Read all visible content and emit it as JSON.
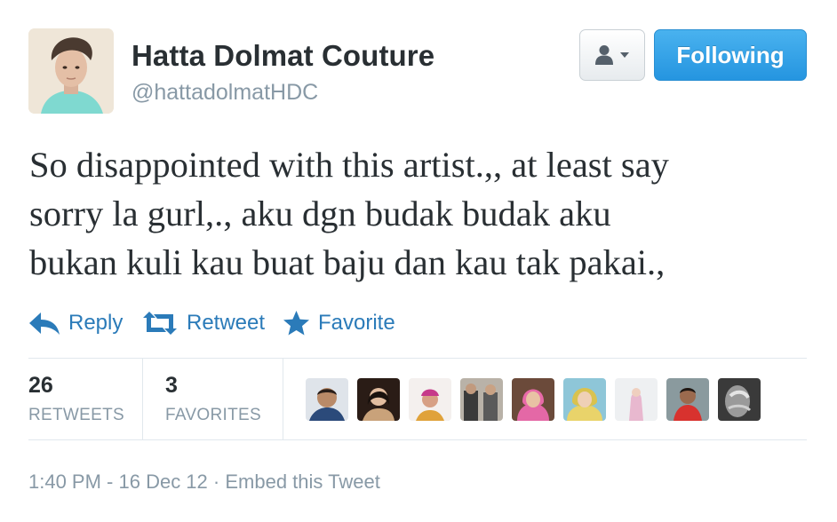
{
  "user": {
    "name": "Hatta Dolmat Couture",
    "screen_name": "@hattadolmatHDC",
    "avatar_icon": "user-avatar-photo"
  },
  "header": {
    "dropdown_icon": "user-silhouette-icon",
    "follow_label": "Following"
  },
  "tweet": {
    "lines": [
      "So disappointed with this artist.,, at least say",
      "sorry la gurl,., aku dgn budak budak aku",
      "bukan kuli kau buat baju dan kau tak pakai.,"
    ]
  },
  "actions": {
    "reply": "Reply",
    "retweet": "Retweet",
    "favorite": "Favorite"
  },
  "stats": {
    "retweets_count": "26",
    "retweets_label": "RETWEETS",
    "favorites_count": "3",
    "favorites_label": "FAVORITES"
  },
  "favoriters": [
    {
      "avatar_icon": "user-avatar-photo"
    },
    {
      "avatar_icon": "user-avatar-photo"
    },
    {
      "avatar_icon": "user-avatar-photo"
    },
    {
      "avatar_icon": "user-avatar-photo"
    },
    {
      "avatar_icon": "user-avatar-photo"
    },
    {
      "avatar_icon": "user-avatar-photo"
    },
    {
      "avatar_icon": "user-avatar-photo"
    },
    {
      "avatar_icon": "user-avatar-photo"
    },
    {
      "avatar_icon": "user-avatar-photo"
    }
  ],
  "footer": {
    "timestamp": "1:40 PM - 16 Dec 12",
    "separator": " · ",
    "embed_label": "Embed this Tweet"
  },
  "colors": {
    "link": "#2b7bb9",
    "follow_button": "#2595e0",
    "muted": "#8899a6",
    "text": "#292f33"
  }
}
